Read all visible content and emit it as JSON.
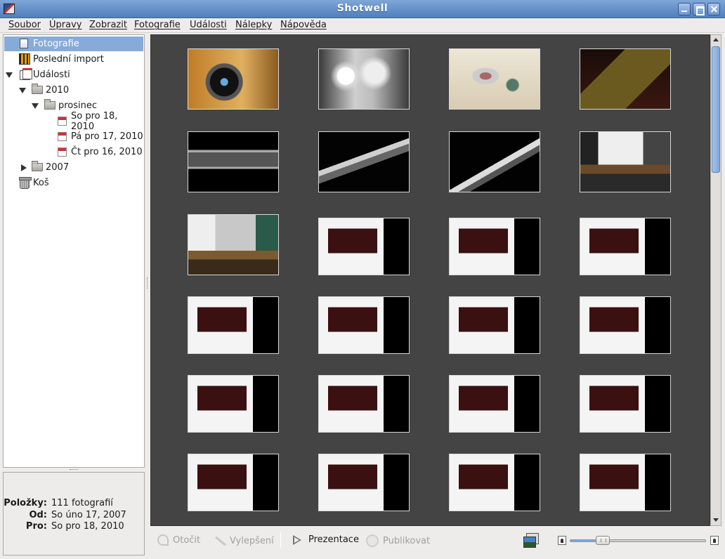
{
  "window": {
    "title": "Shotwell"
  },
  "menu": [
    "Soubor",
    "Úpravy",
    "Zobrazit",
    "Fotografie",
    "Události",
    "Nálepky",
    "Nápověda"
  ],
  "sidebar": {
    "items": [
      {
        "label": "Fotografie",
        "icon": "photos-icon",
        "selected": true
      },
      {
        "label": "Poslední import",
        "icon": "import-icon"
      },
      {
        "label": "Události",
        "icon": "events-icon",
        "expanded": true
      },
      {
        "label": "2010",
        "icon": "folder-icon",
        "expanded": true
      },
      {
        "label": "prosinec",
        "icon": "folder-icon",
        "expanded": true
      },
      {
        "label": "So pro 18, 2010",
        "icon": "calendar-icon"
      },
      {
        "label": "Pá pro 17, 2010",
        "icon": "calendar-icon"
      },
      {
        "label": "Čt pro 16, 2010",
        "icon": "calendar-icon"
      },
      {
        "label": "2007",
        "icon": "folder-icon",
        "expanded": false
      },
      {
        "label": "Koš",
        "icon": "trash-icon"
      }
    ]
  },
  "info": {
    "items_label": "Položky:",
    "items_value": "111 fotografií",
    "from_label": "Od:",
    "from_value": "So úno 17, 2007",
    "to_label": "Pro:",
    "to_value": "So pro 18, 2010"
  },
  "photos": [
    {
      "kind": "lens"
    },
    {
      "kind": "bulbs"
    },
    {
      "kind": "parts"
    },
    {
      "kind": "dark-frame"
    },
    {
      "kind": "dark-strip"
    },
    {
      "kind": "dark-angle"
    },
    {
      "kind": "dark-angle2"
    },
    {
      "kind": "lecture"
    },
    {
      "kind": "lecture2"
    },
    {
      "kind": "screenshot"
    },
    {
      "kind": "screenshot"
    },
    {
      "kind": "screenshot"
    },
    {
      "kind": "screenshot"
    },
    {
      "kind": "screenshot"
    },
    {
      "kind": "screenshot"
    },
    {
      "kind": "screenshot"
    },
    {
      "kind": "screenshot"
    },
    {
      "kind": "screenshot"
    },
    {
      "kind": "screenshot"
    },
    {
      "kind": "screenshot"
    },
    {
      "kind": "screenshot"
    },
    {
      "kind": "screenshot"
    },
    {
      "kind": "screenshot"
    },
    {
      "kind": "screenshot"
    }
  ],
  "toolbar": {
    "rotate_label": "Otočit",
    "enhance_label": "Vylepšení",
    "slideshow_label": "Prezentace",
    "publish_label": "Publikovat",
    "zoom_level": 0.2
  }
}
